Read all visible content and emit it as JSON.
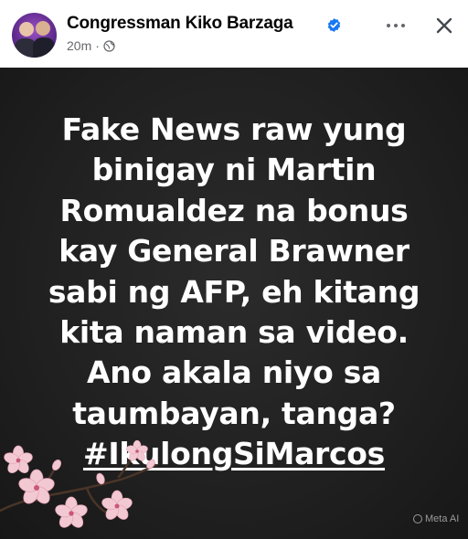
{
  "post": {
    "author": "Congressman Kiko Barzaga",
    "time": "20m",
    "separator": "·",
    "text_lines": [
      "Fake News raw yung",
      "binigay ni Martin",
      "Romualdez na bonus",
      "kay General Brawner",
      "sabi ng AFP, eh kitang",
      "kita naman sa video.",
      "Ano akala niyo sa",
      "taumbayan, tanga?"
    ],
    "hashtag": "#IkulongSiMarcos",
    "badge": "Meta AI"
  },
  "icons": {
    "verified": "verified-badge-icon",
    "privacy": "globe-icon",
    "more": "more-options-icon",
    "close": "close-icon"
  },
  "colors": {
    "verified_blue": "#1877f2",
    "card_background": "#222222",
    "text_white": "#ffffff",
    "secondary_text": "#65676b"
  }
}
